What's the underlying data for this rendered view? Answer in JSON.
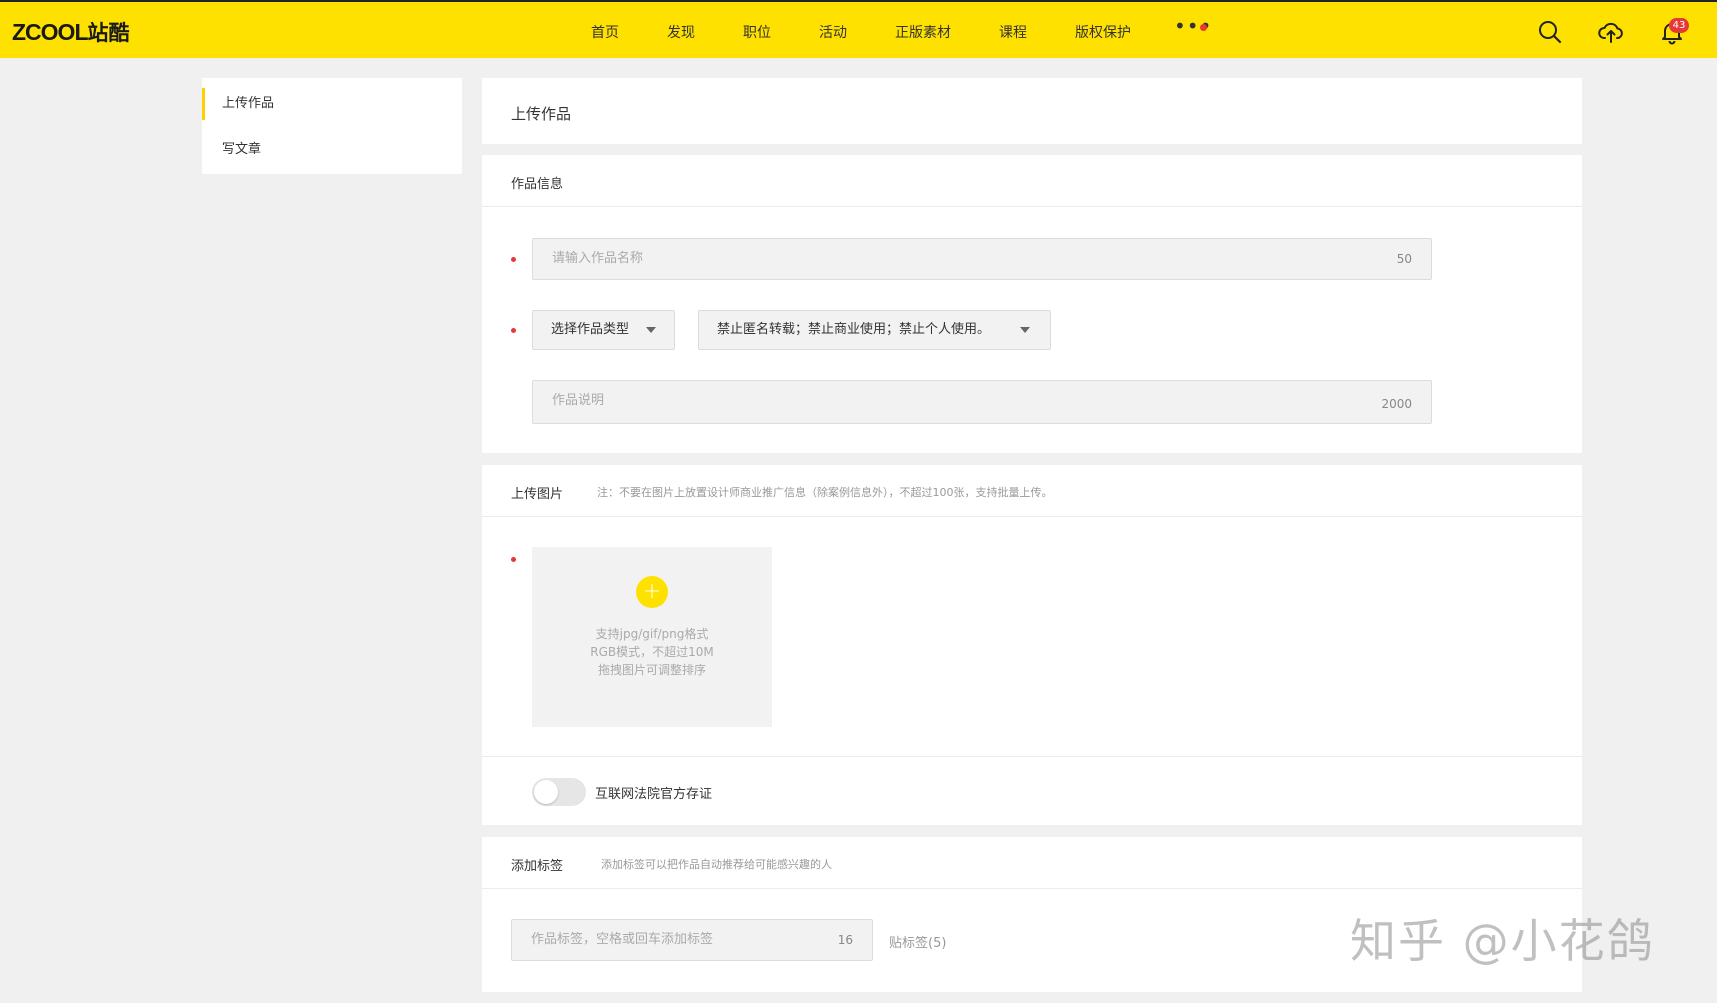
{
  "header": {
    "logo_text": "ZCOOL",
    "logo_cn": "站酷",
    "nav": [
      "首页",
      "发现",
      "职位",
      "活动",
      "正版素材",
      "课程",
      "版权保护"
    ],
    "more_label": "•••",
    "notification_count": "43",
    "brand_color": "#ffe100"
  },
  "sidebar": {
    "items": [
      {
        "label": "上传作品"
      },
      {
        "label": "写文章"
      }
    ]
  },
  "page_title": "上传作品",
  "work_info": {
    "heading": "作品信息",
    "title_input": {
      "placeholder": "请输入作品名称",
      "count": "50"
    },
    "type_select": "选择作品类型",
    "license_select": "禁止匿名转载；禁止商业使用；禁止个人使用。",
    "desc_input": {
      "placeholder": "作品说明",
      "count": "2000"
    }
  },
  "upload_images": {
    "heading": "上传图片",
    "note": "注：不要在图片上放置设计师商业推广信息（除案例信息外），不超过100张，支持批量上传。",
    "hint_lines": [
      "支持jpg/gif/png格式",
      "RGB模式，不超过10M",
      "拖拽图片可调整排序"
    ],
    "toggle_label": "互联网法院官方存证"
  },
  "tags": {
    "heading": "添加标签",
    "note": "添加标签可以把作品自动推荐给可能感兴趣的人",
    "input": {
      "placeholder": "作品标签，空格或回车添加标签",
      "count": "16"
    },
    "paste_label": "贴标签(5)"
  },
  "watermark": "知乎 @小花鸽"
}
